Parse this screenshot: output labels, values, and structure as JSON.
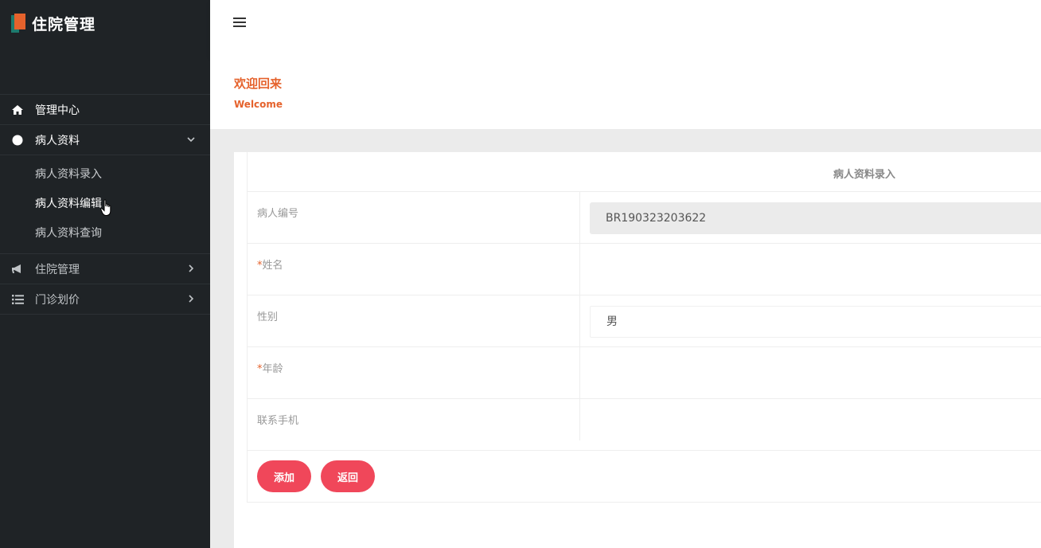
{
  "app": {
    "title": "住院管理"
  },
  "sidebar": {
    "items": [
      {
        "label": "管理中心",
        "icon": "home-icon"
      },
      {
        "label": "病人资料",
        "icon": "circle-icon",
        "expanded": true,
        "children": [
          {
            "label": "病人资料录入"
          },
          {
            "label": "病人资料编辑"
          },
          {
            "label": "病人资料查询"
          }
        ]
      },
      {
        "label": "住院管理",
        "icon": "megaphone-icon"
      },
      {
        "label": "门诊划价",
        "icon": "list-icon"
      }
    ]
  },
  "welcome": {
    "title": "欢迎回来",
    "subtitle": "Welcome"
  },
  "form": {
    "title": "病人资料录入",
    "fields": [
      {
        "label": "病人编号",
        "value": "BR190323203622"
      },
      {
        "required_mark": "*",
        "label": "姓名",
        "value": ""
      },
      {
        "label": "性别",
        "value": "男"
      },
      {
        "required_mark": "*",
        "label": "年龄",
        "value": ""
      },
      {
        "label": "联系手机",
        "value": ""
      }
    ],
    "buttons": {
      "add": "添加",
      "back": "返回"
    }
  },
  "colors": {
    "accent": "#e5622c",
    "button": "#f0475a",
    "sidebar_bg": "#1f2326"
  }
}
